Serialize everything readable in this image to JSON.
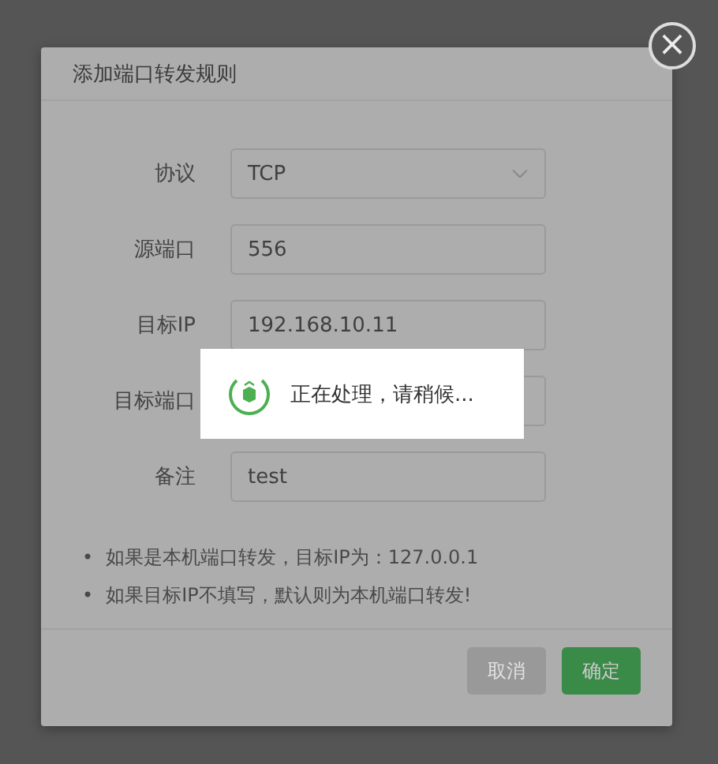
{
  "dialog": {
    "title": "添加端口转发规则",
    "close": "×"
  },
  "fields": [
    {
      "label": "协议",
      "kind": "select",
      "value": "TCP"
    },
    {
      "label": "源端口",
      "kind": "text",
      "value": "556"
    },
    {
      "label": "目标IP",
      "kind": "text",
      "value": "192.168.10.11"
    },
    {
      "label": "目标端口",
      "kind": "text"
    },
    {
      "label": "备注",
      "kind": "text",
      "value": "test"
    }
  ],
  "notes": [
    {
      "bullet": "•",
      "text": "如果是本机端口转发，目标IP为：127.0.0.1"
    },
    {
      "bullet": "•",
      "text": "如果目标IP不填写，默认则为本机端口转发!"
    }
  ],
  "buttons": [
    {
      "label": "取消",
      "kind": "secondary"
    },
    {
      "label": "确定",
      "kind": "primary"
    }
  ],
  "loading": {
    "message": "正在处理，请稍候..."
  }
}
